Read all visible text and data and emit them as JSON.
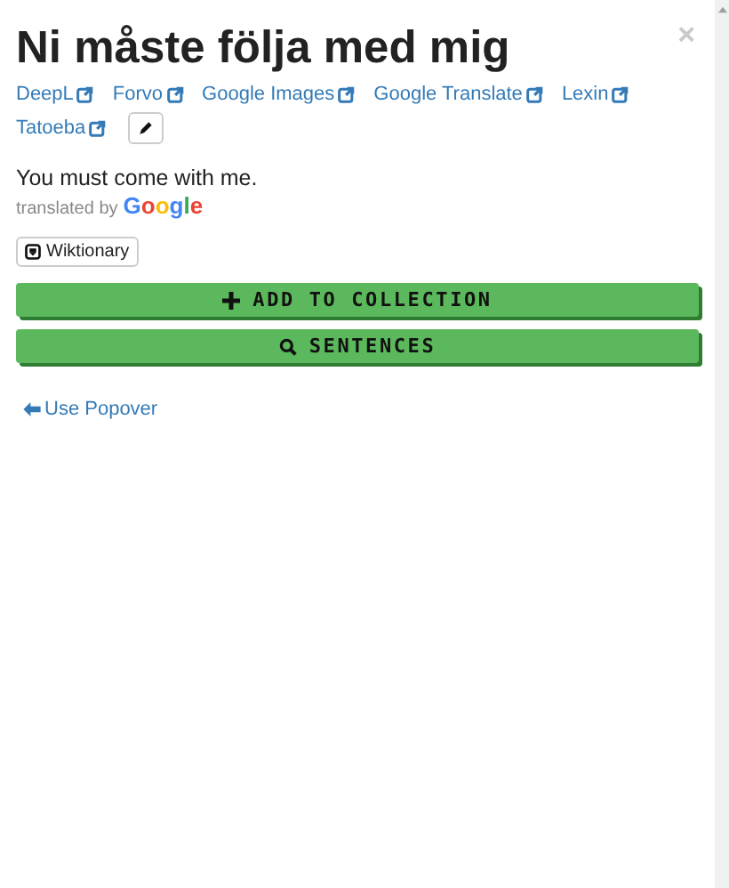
{
  "title": "Ni måste följa med mig",
  "close": "×",
  "links": [
    {
      "label": "DeepL"
    },
    {
      "label": "Forvo"
    },
    {
      "label": "Google Images"
    },
    {
      "label": "Google Translate"
    },
    {
      "label": "Lexin"
    },
    {
      "label": "Tatoeba"
    }
  ],
  "translation": {
    "text": "You must come with me.",
    "credit": "translated by",
    "brand": "Google"
  },
  "wiktionary_button": "Wiktionary",
  "action_buttons": [
    {
      "kind": "add",
      "label": "ADD TO COLLECTION"
    },
    {
      "kind": "search",
      "label": "SENTENCES"
    }
  ],
  "back_link": "Use Popover"
}
